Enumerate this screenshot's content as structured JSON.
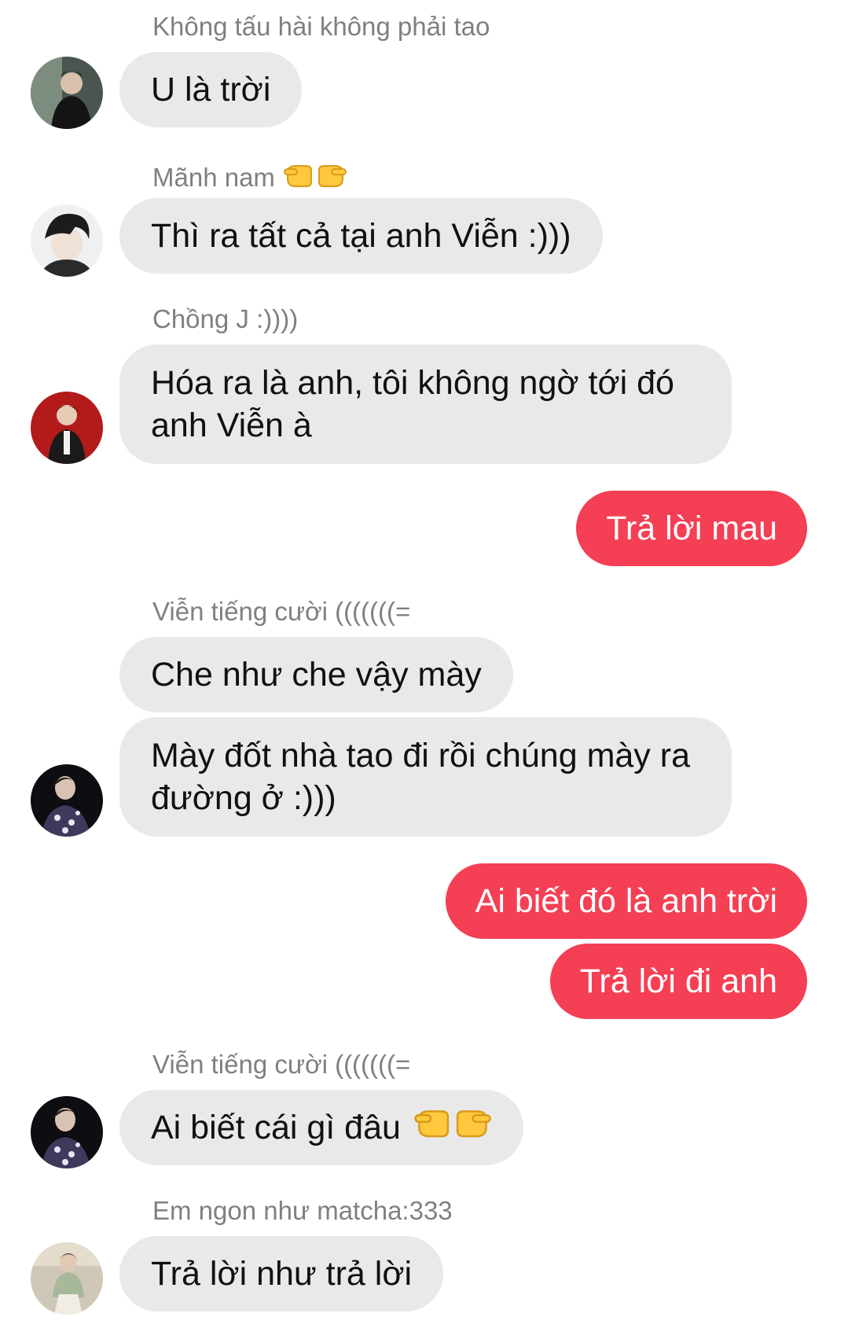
{
  "colors": {
    "incoming_bubble": "#e9e9e9",
    "outgoing_bubble": "#f43f54",
    "sender_name": "#808080"
  },
  "messages": [
    {
      "sender": "Không tấu hài không phải tao",
      "text": "U là trời"
    },
    {
      "sender": "Mãnh nam",
      "sender_icon": "pointing-hands-icon",
      "text": "Thì ra tất cả tại anh Viễn :)))"
    },
    {
      "sender": "Chồng J :))))",
      "text": "Hóa ra là anh, tôi không ngờ tới đó anh Viễn à"
    },
    {
      "outgoing": true,
      "text": "Trả lời mau"
    },
    {
      "sender": "Viễn tiếng cười (((((((=",
      "text": "Che như che vậy mày"
    },
    {
      "text": "Mày đốt nhà tao đi rồi chúng mày ra đường ở :)))"
    },
    {
      "outgoing": true,
      "text": "Ai biết đó là anh trời"
    },
    {
      "outgoing": true,
      "text": "Trả lời đi anh"
    },
    {
      "sender": "Viễn tiếng cười (((((((=",
      "text": "Ai biết cái gì đâu",
      "trailing_icon": "pointing-hands-icon"
    },
    {
      "sender": "Em ngon như matcha:333",
      "text": "Trả lời như trả lời"
    }
  ]
}
